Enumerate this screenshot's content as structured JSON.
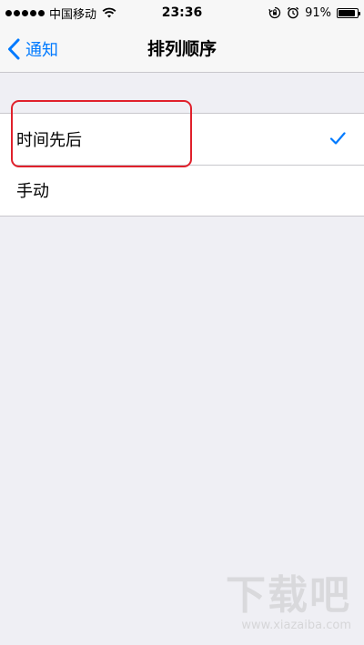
{
  "status_bar": {
    "carrier": "中国移动",
    "time": "23:36",
    "battery_percent": "91%",
    "battery_level": 0.91,
    "icons": [
      "signal-dots-icon",
      "wifi-icon",
      "rotation-lock-icon",
      "alarm-icon",
      "battery-icon"
    ]
  },
  "nav": {
    "back_label": "通知",
    "title": "排列顺序"
  },
  "options": [
    {
      "label": "时间先后",
      "selected": true
    },
    {
      "label": "手动",
      "selected": false
    }
  ],
  "watermark": {
    "brand": "下载吧",
    "url": "www.xiazaiba.com"
  },
  "colors": {
    "accent": "#007aff",
    "background": "#efeff4",
    "highlight": "#e0202b"
  }
}
